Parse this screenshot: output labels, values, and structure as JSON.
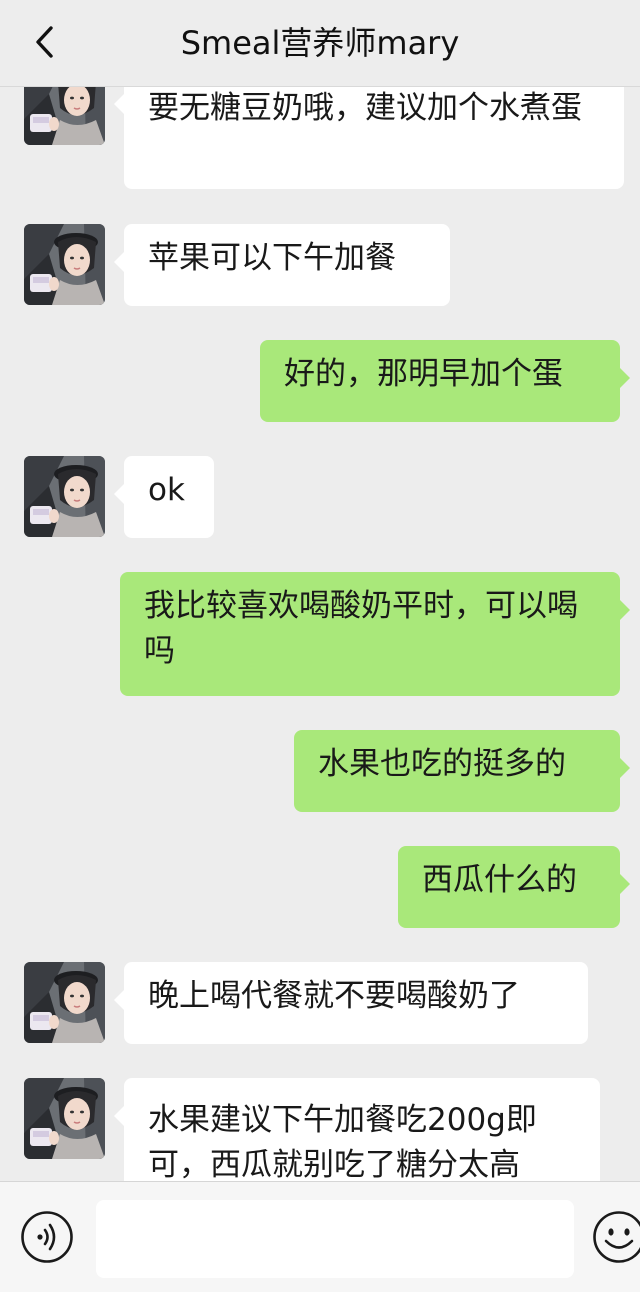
{
  "header": {
    "title": "Smeal营养师mary",
    "back_icon": "chevron-left-icon"
  },
  "colors": {
    "background": "#ededed",
    "incoming_bubble": "#ffffff",
    "outgoing_bubble": "#a9e87a"
  },
  "messages": [
    {
      "side": "incoming",
      "text": "要无糖豆奶哦，建议加个水煮蛋"
    },
    {
      "side": "incoming",
      "text": "苹果可以下午加餐"
    },
    {
      "side": "outgoing",
      "text": "好的，那明早加个蛋"
    },
    {
      "side": "incoming",
      "text": "ok"
    },
    {
      "side": "outgoing",
      "text": "我比较喜欢喝酸奶平时，可以喝吗"
    },
    {
      "side": "outgoing",
      "text": "水果也吃的挺多的"
    },
    {
      "side": "outgoing",
      "text": "西瓜什么的"
    },
    {
      "side": "incoming",
      "text": "晚上喝代餐就不要喝酸奶了"
    },
    {
      "side": "incoming",
      "text": "水果建议下午加餐吃200g即可，西瓜就别吃了糖分太高"
    }
  ],
  "input_bar": {
    "voice_icon": "voice-icon",
    "message_value": "",
    "emoji_icon": "emoji-icon"
  }
}
